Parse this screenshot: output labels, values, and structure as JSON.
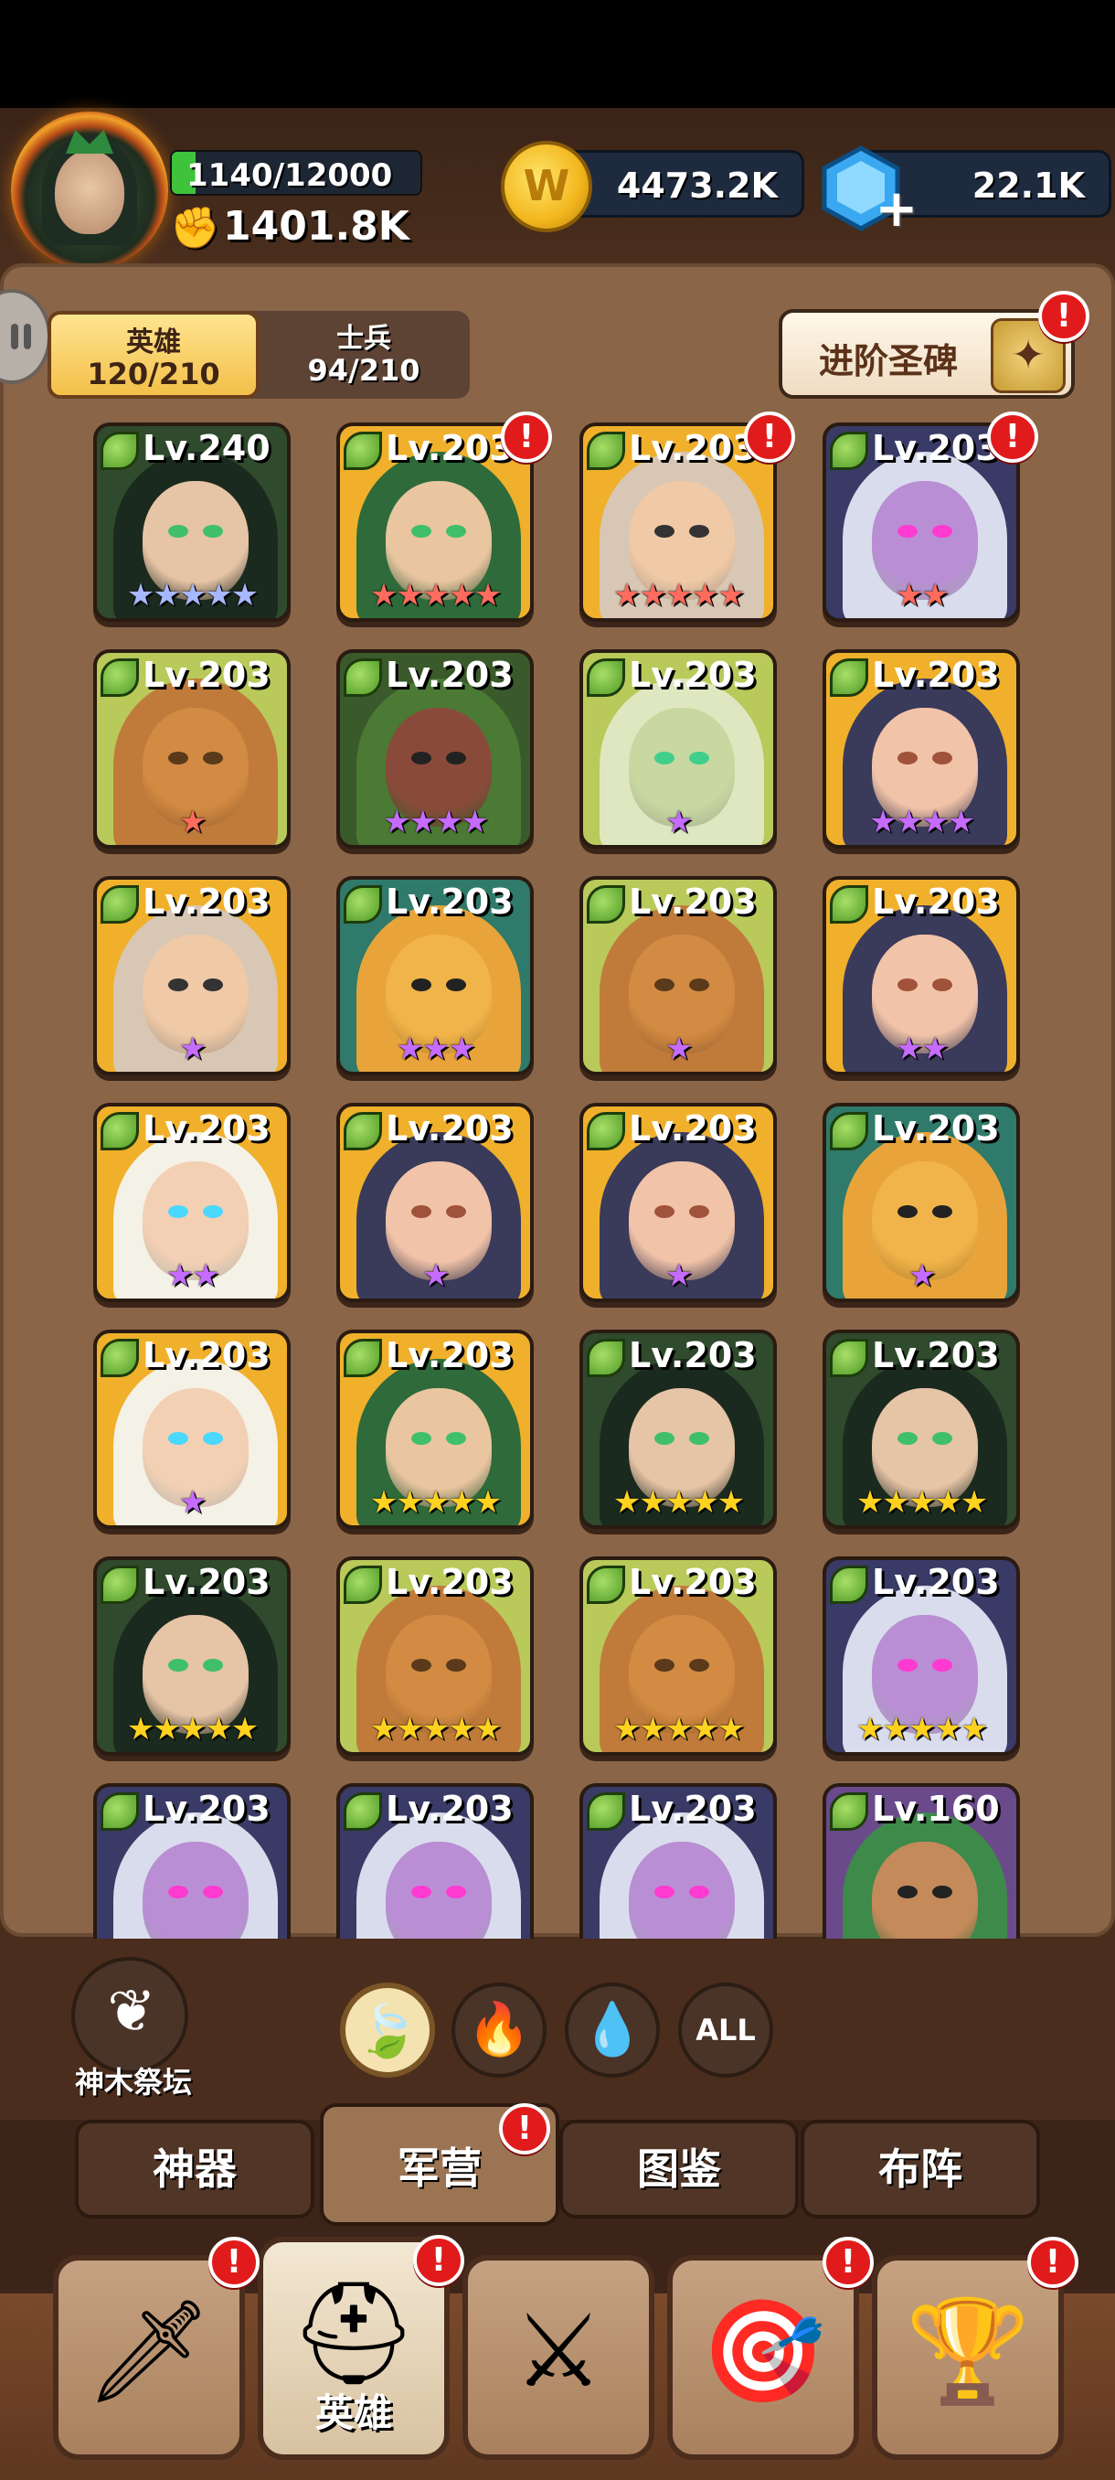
{
  "player": {
    "xp_text": "1140/12000",
    "xp_fraction": 0.095,
    "power": "1401.8K"
  },
  "currencies": {
    "coins": "4473.2K",
    "coin_icon_glyph": "W",
    "gems": "22.1K"
  },
  "segment": {
    "heroes_label": "英雄",
    "heroes_count": "120/210",
    "soldiers_label": "士兵",
    "soldiers_count": "94/210"
  },
  "advance_button": {
    "label": "进阶圣碑"
  },
  "alert_glyph": "!",
  "heroes": [
    {
      "level": "Lv.240",
      "stars": 5,
      "star_color": "#a8b8ff",
      "bg": "#2f4a2c",
      "hair": "#1b2a1e",
      "skin": "#e6c4a6",
      "eye": "#3fbf6a",
      "alert": false
    },
    {
      "level": "Lv.203",
      "stars": 5,
      "star_color": "#ff6b5c",
      "bg": "#f0b02b",
      "hair": "#2e6a3a",
      "skin": "#e9c5a0",
      "eye": "#3fbf6a",
      "alert": true
    },
    {
      "level": "Lv.203",
      "stars": 5,
      "star_color": "#ff6b5c",
      "bg": "#f0b02b",
      "hair": "#d8c7b4",
      "skin": "#f0c9a6",
      "eye": "#333",
      "alert": true
    },
    {
      "level": "Lv.203",
      "stars": 2,
      "star_color": "#ff6b5c",
      "bg": "#3a3a66",
      "hair": "#d9dcec",
      "skin": "#b98ed4",
      "eye": "#ff3ad0",
      "alert": true
    },
    {
      "level": "Lv.203",
      "stars": 1,
      "star_color": "#ff6b5c",
      "bg": "#b9c95a",
      "hair": "#c07b3b",
      "skin": "#d38a42",
      "eye": "#5a3a1a",
      "alert": false
    },
    {
      "level": "Lv.203",
      "stars": 4,
      "star_color": "#c56bff",
      "bg": "#3a5a2c",
      "hair": "#4a7a34",
      "skin": "#8a4a3a",
      "eye": "#222",
      "alert": false
    },
    {
      "level": "Lv.203",
      "stars": 1,
      "star_color": "#c56bff",
      "bg": "#b9c95a",
      "hair": "#dfe7c0",
      "skin": "#c8d8a0",
      "eye": "#3fcf8a",
      "alert": false
    },
    {
      "level": "Lv.203",
      "stars": 4,
      "star_color": "#c56bff",
      "bg": "#f0b02b",
      "hair": "#3a3a5a",
      "skin": "#f1c3a8",
      "eye": "#a0523a",
      "alert": false
    },
    {
      "level": "Lv.203",
      "stars": 1,
      "star_color": "#c56bff",
      "bg": "#f0b02b",
      "hair": "#d8c7b4",
      "skin": "#f0c9a6",
      "eye": "#333",
      "alert": false
    },
    {
      "level": "Lv.203",
      "stars": 3,
      "star_color": "#c56bff",
      "bg": "#2f7a6a",
      "hair": "#e8a43a",
      "skin": "#f1b44a",
      "eye": "#222",
      "alert": false
    },
    {
      "level": "Lv.203",
      "stars": 1,
      "star_color": "#c56bff",
      "bg": "#b9c95a",
      "hair": "#c07b3b",
      "skin": "#d38a42",
      "eye": "#5a3a1a",
      "alert": false
    },
    {
      "level": "Lv.203",
      "stars": 2,
      "star_color": "#c56bff",
      "bg": "#f0b02b",
      "hair": "#3a3a5a",
      "skin": "#f1c3a8",
      "eye": "#a0523a",
      "alert": false
    },
    {
      "level": "Lv.203",
      "stars": 2,
      "star_color": "#c56bff",
      "bg": "#f0b02b",
      "hair": "#f4f1e6",
      "skin": "#f3d0b4",
      "eye": "#4ad8ff",
      "alert": false
    },
    {
      "level": "Lv.203",
      "stars": 1,
      "star_color": "#c56bff",
      "bg": "#f0b02b",
      "hair": "#3a3a5a",
      "skin": "#f1c3a8",
      "eye": "#a0523a",
      "alert": false
    },
    {
      "level": "Lv.203",
      "stars": 1,
      "star_color": "#c56bff",
      "bg": "#f0b02b",
      "hair": "#3a3a5a",
      "skin": "#f1c3a8",
      "eye": "#a0523a",
      "alert": false
    },
    {
      "level": "Lv.203",
      "stars": 1,
      "star_color": "#c56bff",
      "bg": "#2f7a6a",
      "hair": "#e8a43a",
      "skin": "#f1b44a",
      "eye": "#222",
      "alert": false
    },
    {
      "level": "Lv.203",
      "stars": 1,
      "star_color": "#c56bff",
      "bg": "#f0b02b",
      "hair": "#f4f1e6",
      "skin": "#f3d0b4",
      "eye": "#4ad8ff",
      "alert": false
    },
    {
      "level": "Lv.203",
      "stars": 5,
      "star_color": "#ffd21f",
      "bg": "#f0b02b",
      "hair": "#2e6a3a",
      "skin": "#e9c5a0",
      "eye": "#3fbf6a",
      "alert": false
    },
    {
      "level": "Lv.203",
      "stars": 5,
      "star_color": "#ffd21f",
      "bg": "#2f4a2c",
      "hair": "#1b2a1e",
      "skin": "#e6c4a6",
      "eye": "#3fbf6a",
      "alert": false
    },
    {
      "level": "Lv.203",
      "stars": 5,
      "star_color": "#ffd21f",
      "bg": "#2f4a2c",
      "hair": "#1b2a1e",
      "skin": "#e6c4a6",
      "eye": "#3fbf6a",
      "alert": false
    },
    {
      "level": "Lv.203",
      "stars": 5,
      "star_color": "#ffd21f",
      "bg": "#2f4a2c",
      "hair": "#1b2a1e",
      "skin": "#e6c4a6",
      "eye": "#3fbf6a",
      "alert": false
    },
    {
      "level": "Lv.203",
      "stars": 5,
      "star_color": "#ffd21f",
      "bg": "#b9c95a",
      "hair": "#c07b3b",
      "skin": "#d38a42",
      "eye": "#5a3a1a",
      "alert": false
    },
    {
      "level": "Lv.203",
      "stars": 5,
      "star_color": "#ffd21f",
      "bg": "#b9c95a",
      "hair": "#c07b3b",
      "skin": "#d38a42",
      "eye": "#5a3a1a",
      "alert": false
    },
    {
      "level": "Lv.203",
      "stars": 5,
      "star_color": "#ffd21f",
      "bg": "#3a3a66",
      "hair": "#d9dcec",
      "skin": "#b98ed4",
      "eye": "#ff3ad0",
      "alert": false
    },
    {
      "level": "Lv.203",
      "stars": 0,
      "star_color": "#ffd21f",
      "bg": "#3a3a66",
      "hair": "#d9dcec",
      "skin": "#b98ed4",
      "eye": "#ff3ad0",
      "alert": false
    },
    {
      "level": "Lv.203",
      "stars": 0,
      "star_color": "#ffd21f",
      "bg": "#3a3a66",
      "hair": "#d9dcec",
      "skin": "#b98ed4",
      "eye": "#ff3ad0",
      "alert": false
    },
    {
      "level": "Lv.203",
      "stars": 0,
      "star_color": "#ffd21f",
      "bg": "#3a3a66",
      "hair": "#d9dcec",
      "skin": "#b98ed4",
      "eye": "#ff3ad0",
      "alert": false
    },
    {
      "level": "Lv.160",
      "stars": 0,
      "star_color": "#ffd21f",
      "bg": "#6a4a8a",
      "hair": "#3e8a4a",
      "skin": "#c58a5a",
      "eye": "#222",
      "alert": false
    }
  ],
  "altar": {
    "label": "神木祭坛",
    "icon": "tree-sprout-icon"
  },
  "filters": [
    {
      "name": "leaf",
      "icon": "leaf-icon",
      "glyph": "🍃",
      "active": true
    },
    {
      "name": "fire",
      "icon": "fire-icon",
      "glyph": "🔥",
      "active": false
    },
    {
      "name": "water",
      "icon": "water-drop-icon",
      "glyph": "💧",
      "active": false
    },
    {
      "name": "all",
      "label": "ALL",
      "active": false
    }
  ],
  "sub_tabs": [
    {
      "label": "神器",
      "active": false,
      "alert": false
    },
    {
      "label": "军营",
      "active": true,
      "alert": true
    },
    {
      "label": "图鉴",
      "active": false,
      "alert": false
    },
    {
      "label": "布阵",
      "active": false,
      "alert": false
    }
  ],
  "bottom_nav": [
    {
      "icon": "sword-banner-icon",
      "glyph": "🗡",
      "label": "",
      "active": false,
      "alert": true
    },
    {
      "icon": "viking-helmet-icon",
      "glyph": "⛑",
      "label": "英雄",
      "active": true,
      "alert": true
    },
    {
      "icon": "crossed-swords-icon",
      "glyph": "⚔",
      "label": "",
      "active": false,
      "alert": false
    },
    {
      "icon": "target-icon",
      "glyph": "🎯",
      "label": "",
      "active": false,
      "alert": true
    },
    {
      "icon": "trophy-icon",
      "glyph": "🏆",
      "label": "",
      "active": false,
      "alert": true
    }
  ]
}
